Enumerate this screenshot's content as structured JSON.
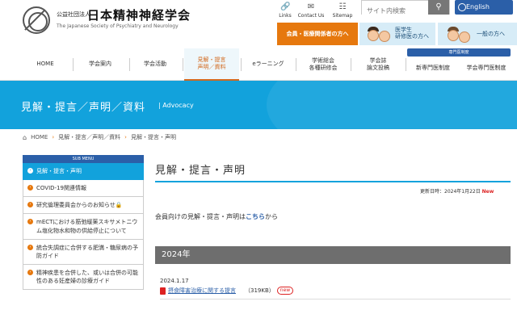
{
  "header": {
    "org_type": "公益社団法人",
    "title": "日本精神神経学会",
    "title_en": "The Japanese Society of Psychiatry and Neurology",
    "utils": [
      {
        "label": "Links",
        "icon": "link-icon"
      },
      {
        "label": "Contact Us",
        "icon": "mail-icon"
      },
      {
        "label": "Sitemap",
        "icon": "sitemap-icon"
      }
    ],
    "search_placeholder": "サイト内検索",
    "english_label": "English",
    "audience": {
      "members": "会員・医療関係者の方へ",
      "students_line1": "医学生",
      "students_line2": "研修医の方へ",
      "public": "一般の方へ"
    }
  },
  "nav": {
    "items": [
      {
        "line1": "HOME",
        "line2": ""
      },
      {
        "line1": "学会案内",
        "line2": ""
      },
      {
        "line1": "学会活動",
        "line2": ""
      },
      {
        "line1": "見解・提言",
        "line2": "声明／資料"
      },
      {
        "line1": "eラーニング",
        "line2": ""
      },
      {
        "line1": "学術総会",
        "line2": "各種研修会"
      },
      {
        "line1": "学会誌",
        "line2": "論文投稿"
      },
      {
        "line1": "新専門医制度",
        "line2": ""
      },
      {
        "line1": "学会専門医制度",
        "line2": ""
      }
    ],
    "specialist_badge": "専門医制度"
  },
  "banner": {
    "title": "見解・提言／声明／資料",
    "subtitle": "| Advocacy"
  },
  "breadcrumb": {
    "home": "HOME",
    "level1": "見解・提言／声明／資料",
    "level2": "見解・提言・声明"
  },
  "sidebar": {
    "heading": "SUB MENU",
    "items": [
      {
        "label": "見解・提言・声明",
        "active": true
      },
      {
        "label": "COVID-19関連情報",
        "active": false
      },
      {
        "label": "研究倫理委員会からのお知らせ",
        "active": false,
        "lock": true
      },
      {
        "label": "mECTにおける筋弛緩薬スキサメトニウム塩化物水和物の供給停止について",
        "active": false
      },
      {
        "label": "統合失調症に合併する肥満・糖尿病の予防ガイド",
        "active": false
      },
      {
        "label": "精神疾患を合併した、或いは合併の可能性のある妊産婦の診療ガイド",
        "active": false
      }
    ]
  },
  "main": {
    "title": "見解・提言・声明",
    "updated_label": "更新日時：2024年1月22日",
    "updated_new": "New",
    "intro_before": "会員向けの見解・提言・声明は",
    "intro_link": "こちら",
    "intro_after": "から",
    "year": "2024年",
    "entries": [
      {
        "date": "2024.1.17",
        "title": "摂食障害治療に関する提言",
        "size": "（319KB）",
        "tag": "new"
      }
    ]
  }
}
